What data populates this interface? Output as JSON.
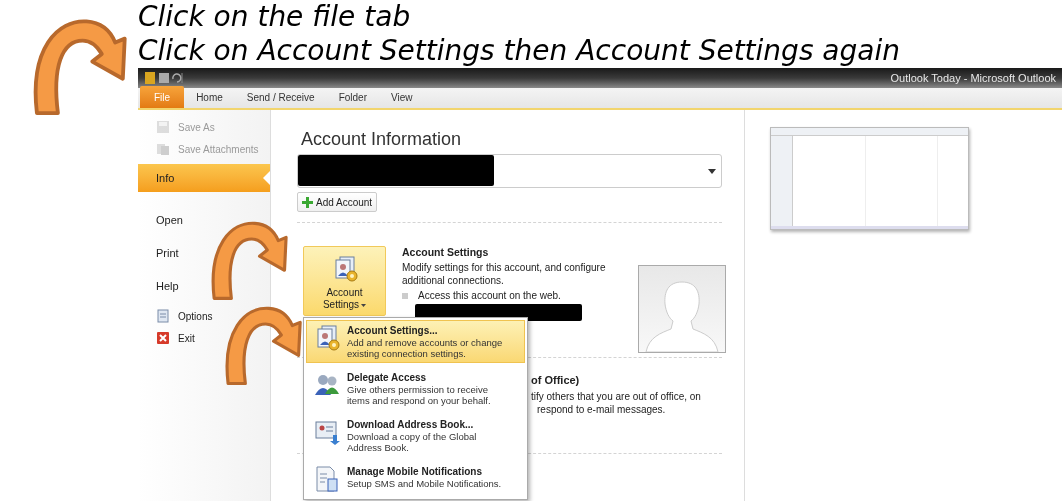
{
  "instructions": [
    "Click on the file tab",
    "Click on Account Settings then Account Settings again"
  ],
  "window": {
    "title": "Outlook Today - Microsoft Outlook"
  },
  "tabs": [
    {
      "label": "File",
      "selected": true
    },
    {
      "label": "Home",
      "selected": false
    },
    {
      "label": "Send / Receive",
      "selected": false
    },
    {
      "label": "Folder",
      "selected": false
    },
    {
      "label": "View",
      "selected": false
    }
  ],
  "sidebar": {
    "items": [
      {
        "label": "Save As",
        "kind": "save",
        "disabled": true,
        "selected": false
      },
      {
        "label": "Save Attachments",
        "kind": "attachments",
        "disabled": true,
        "selected": false
      },
      {
        "label": "Info",
        "kind": "page",
        "disabled": false,
        "selected": true
      },
      {
        "label": "Open",
        "kind": "page",
        "disabled": false,
        "selected": false
      },
      {
        "label": "Print",
        "kind": "page",
        "disabled": false,
        "selected": false
      },
      {
        "label": "Help",
        "kind": "page",
        "disabled": false,
        "selected": false
      },
      {
        "label": "Options",
        "kind": "options",
        "disabled": false,
        "selected": false
      },
      {
        "label": "Exit",
        "kind": "exit",
        "disabled": false,
        "selected": false
      }
    ]
  },
  "account_information": {
    "heading": "Account Information",
    "add_account": "Add Account"
  },
  "account_settings": {
    "button_lines": [
      "Account",
      "Settings"
    ],
    "title": "Account Settings",
    "description": "Modify settings for this account, and configure additional connections.",
    "link": "Access this account on the web."
  },
  "out_of_office": {
    "title": "of Office)",
    "lines": [
      "tify others that you are out of office, on",
      "respond to e-mail messages."
    ]
  },
  "dropdown_menu": {
    "items": [
      {
        "title": "Account Settings...",
        "description": "Add and remove accounts or change existing connection settings.",
        "kind": "settings",
        "selected": true
      },
      {
        "title": "Delegate Access",
        "description": "Give others permission to receive items and respond on your behalf.",
        "kind": "people",
        "selected": false
      },
      {
        "title": "Download Address Book...",
        "description": "Download a copy of the Global Address Book.",
        "kind": "addressbook",
        "selected": false
      },
      {
        "title": "Manage Mobile Notifications",
        "description": "Setup SMS and Mobile Notifications.",
        "kind": "mobile",
        "selected": false
      }
    ]
  }
}
